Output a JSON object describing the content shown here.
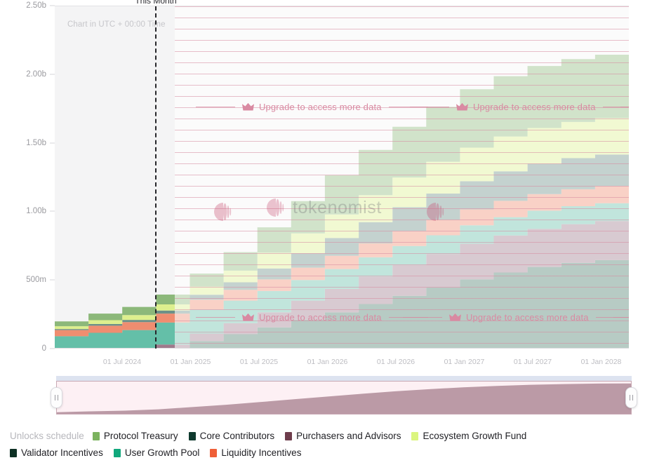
{
  "chart_note": "Chart in UTC + 00:00 Time",
  "marker_label": "This Month",
  "upgrade_text": "Upgrade to access more data",
  "watermark_text": "tokenomist",
  "legend": {
    "title": "Unlocks schedule",
    "items": [
      {
        "label": "Protocol Treasury",
        "color": "#7cb35f"
      },
      {
        "label": "Core Contributors",
        "color": "#0f3a2e"
      },
      {
        "label": "Purchasers and Advisors",
        "color": "#6e3d4c"
      },
      {
        "label": "Ecosystem Growth Fund",
        "color": "#dbf57f"
      },
      {
        "label": "Validator Incentives",
        "color": "#0d3024"
      },
      {
        "label": "User Growth Pool",
        "color": "#11a87c"
      },
      {
        "label": "Liquidity Incentives",
        "color": "#ef5f37"
      }
    ]
  },
  "chart_data": {
    "type": "area",
    "title": "Unlocks schedule",
    "xlabel": "",
    "ylabel": "",
    "stacked": true,
    "grid": false,
    "legend_position": "bottom",
    "ylim": [
      0,
      2500000000
    ],
    "y_ticks": [
      "0",
      "500m",
      "1.00b",
      "1.50b",
      "2.00b",
      "2.50b"
    ],
    "y_tick_values": [
      0,
      500000000,
      1000000000,
      1500000000,
      2000000000,
      2500000000
    ],
    "x_ticks": [
      "01 Jul 2024",
      "01 Jan 2025",
      "01 Jul 2025",
      "01 Jan 2026",
      "01 Jul 2026",
      "01 Jan 2027",
      "01 Jul 2027",
      "01 Jan 2028"
    ],
    "x": [
      "2024-01",
      "2024-04",
      "2024-07",
      "2024-10",
      "2025-01",
      "2025-04",
      "2025-07",
      "2025-10",
      "2026-01",
      "2026-04",
      "2026-07",
      "2026-10",
      "2027-01",
      "2027-04",
      "2027-07",
      "2027-10",
      "2028-01",
      "2028-04"
    ],
    "series": [
      {
        "name": "Core Contributors",
        "color": "#4d7e6c",
        "values": [
          0,
          0,
          0,
          0,
          60000000,
          110000000,
          160000000,
          215000000,
          270000000,
          330000000,
          390000000,
          450000000,
          510000000,
          560000000,
          600000000,
          630000000,
          650000000,
          655000000
        ]
      },
      {
        "name": "Purchasers and Advisors",
        "color": "#9f7a8c",
        "values": [
          0,
          0,
          0,
          35000000,
          55000000,
          80000000,
          110000000,
          140000000,
          170000000,
          200000000,
          225000000,
          245000000,
          260000000,
          270000000,
          278000000,
          282000000,
          285000000,
          286000000
        ]
      },
      {
        "name": "User Growth Pool",
        "color": "#64bfa8",
        "values": [
          95000000,
          120000000,
          140000000,
          160000000,
          175000000,
          165000000,
          155000000,
          150000000,
          145000000,
          140000000,
          138000000,
          136000000,
          134000000,
          133000000,
          132000000,
          131000000,
          130000000,
          130000000
        ]
      },
      {
        "name": "Liquidity Incentives",
        "color": "#ef8d70",
        "values": [
          45000000,
          52000000,
          58000000,
          65000000,
          72000000,
          78000000,
          84000000,
          90000000,
          96000000,
          102000000,
          108000000,
          112000000,
          116000000,
          119000000,
          121000000,
          123000000,
          124000000,
          125000000
        ]
      },
      {
        "name": "Validator Incentives",
        "color": "#6d9088",
        "values": [
          8000000,
          12000000,
          16000000,
          22000000,
          35000000,
          55000000,
          80000000,
          105000000,
          130000000,
          155000000,
          175000000,
          192000000,
          205000000,
          215000000,
          222000000,
          227000000,
          230000000,
          231000000
        ]
      },
      {
        "name": "Ecosystem Growth Fund",
        "color": "#ddef8e",
        "values": [
          20000000,
          28000000,
          35000000,
          45000000,
          60000000,
          85000000,
          115000000,
          145000000,
          172000000,
          196000000,
          216000000,
          232000000,
          245000000,
          254000000,
          260000000,
          264000000,
          266000000,
          267000000
        ]
      },
      {
        "name": "Protocol Treasury",
        "color": "#8cb87a",
        "values": [
          35000000,
          48000000,
          60000000,
          72000000,
          95000000,
          135000000,
          185000000,
          235000000,
          285000000,
          330000000,
          370000000,
          400000000,
          425000000,
          440000000,
          452000000,
          458000000,
          462000000,
          463000000
        ]
      }
    ],
    "total_at_end": 2090000000,
    "annotations": [
      {
        "text": "This Month",
        "x": "2024-11"
      },
      {
        "text": "Chart in UTC + 00:00 Time"
      }
    ]
  }
}
